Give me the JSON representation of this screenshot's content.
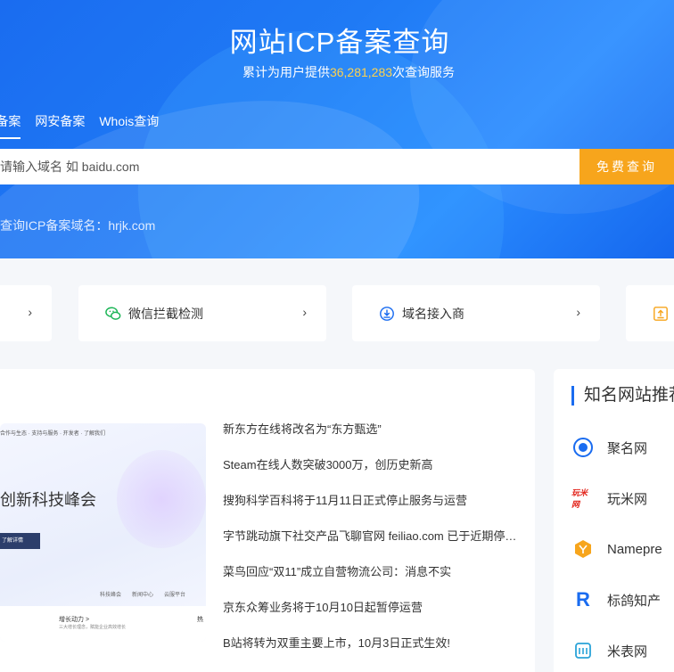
{
  "hero": {
    "title": "网站ICP备案查询",
    "subtitle_prefix": "累计为用户提供",
    "count": "36,281,283",
    "subtitle_suffix": "次查询服务",
    "tabs": [
      "P备案",
      "网安备案",
      "Whois查询"
    ],
    "search_placeholder": "请输入域名 如 baidu.com",
    "search_button": "免费查询",
    "recent": "近查询ICP备案域名：hrjk.com"
  },
  "tools": [
    {
      "label": "",
      "icon": "chevron-right-icon"
    },
    {
      "label": "微信拦截检测",
      "icon": "wechat-icon"
    },
    {
      "label": "域名接入商",
      "icon": "download-circle-icon"
    },
    {
      "label": "",
      "icon": "upload-box-icon"
    }
  ],
  "news": {
    "image": {
      "nav": "合作与生态  ·  支持与服务  ·  开发者  ·  了解我们",
      "headline": "创新科技峰会",
      "button": "了解详情",
      "tabs": [
        "科技峰会",
        "新闻中心",
        "云服平台"
      ],
      "sub_title": "增长动力 >",
      "sub_desc": "三大增长理念，赋能企业高效增长",
      "sub_title2": "热"
    },
    "items": [
      "新东方在线将改名为“东方甄选”",
      "Steam在线人数突破3000万，创历史新高",
      "搜狗科学百科将于11月11日正式停止服务与运营",
      "字节跳动旗下社交产品飞聊官网 feiliao.com 已于近期停止服务",
      "菜鸟回应“双11”成立自营物流公司：消息不实",
      "京东众筹业务将于10月10日起暂停运营",
      "B站将转为双重主要上市，10月3日正式生效!"
    ]
  },
  "sites": {
    "title": "知名网站推荐",
    "items": [
      {
        "name": "聚名网",
        "icon": "juming-logo-icon"
      },
      {
        "name": "玩米网",
        "icon": "wanmi-logo-icon",
        "logo_text": "玩米网"
      },
      {
        "name": "Namepre",
        "icon": "namepre-logo-icon"
      },
      {
        "name": "标鸽知产",
        "icon": "biaoge-logo-icon"
      },
      {
        "name": "米表网",
        "icon": "mibiao-logo-icon"
      }
    ]
  },
  "colors": {
    "brand_blue": "#1a6cf0",
    "accent_orange": "#f7a51c",
    "count_yellow": "#ffd24d"
  }
}
